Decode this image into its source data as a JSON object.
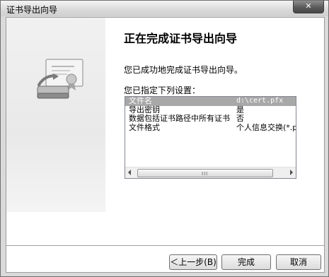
{
  "window": {
    "title": "证书导出向导",
    "close_glyph": "✕"
  },
  "heading": "正在完成证书导出向导",
  "success_text": "您已成功地完成证书导出向导。",
  "specified_label": "您已指定下列设置：",
  "settings": [
    {
      "name": "文件名",
      "value": "d:\\cert.pfx",
      "selected": true
    },
    {
      "name": "导出密钥",
      "value": "是",
      "selected": false
    },
    {
      "name": "数据包括证书路径中所有证书",
      "value": "否",
      "selected": false
    },
    {
      "name": "文件格式",
      "value": "个人信息交换(*.p",
      "selected": false
    }
  ],
  "scrollbar": {
    "grip": "III"
  },
  "buttons": {
    "back": "＜上一步(B)",
    "finish": "完成",
    "cancel": "取消"
  },
  "colors": {
    "selected_row": "#a8a8a8",
    "left_panel": "#eeeeee"
  },
  "icons": {
    "wizard": "certificate-export-icon"
  }
}
